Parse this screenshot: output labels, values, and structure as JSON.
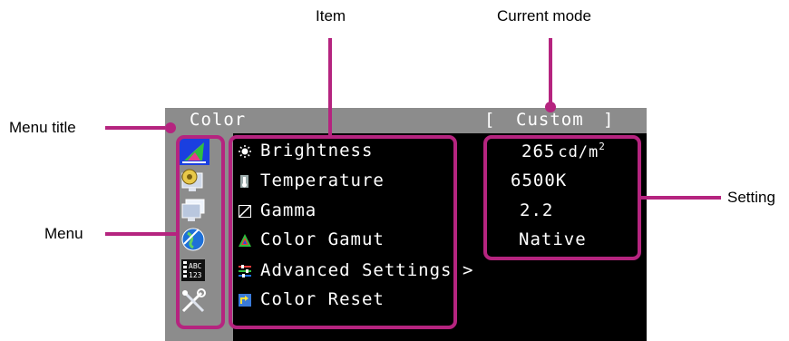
{
  "callouts": {
    "item": "Item",
    "current_mode": "Current mode",
    "menu_title": "Menu title",
    "menu": "Menu",
    "setting": "Setting"
  },
  "osd": {
    "title": "Color",
    "mode_open": "[",
    "mode": "Custom",
    "mode_close": "]",
    "items": [
      {
        "label": "Brightness",
        "icon": "brightness-icon"
      },
      {
        "label": "Temperature",
        "icon": "thermometer-icon"
      },
      {
        "label": "Gamma",
        "icon": "gamma-icon"
      },
      {
        "label": "Color Gamut",
        "icon": "color-gamut-icon"
      },
      {
        "label": "Advanced Settings",
        "icon": "advanced-settings-icon",
        "arrow": ">"
      },
      {
        "label": "Color Reset",
        "icon": "color-reset-icon"
      }
    ],
    "settings": {
      "brightness_value": "265",
      "brightness_unit": "cd/m",
      "brightness_sup": "2",
      "temperature": "6500K",
      "gamma": "2.2",
      "color_gamut": "Native"
    },
    "menu_icons": [
      "color-menu-icon",
      "signal-menu-icon",
      "preferences-menu-icon",
      "language-menu-icon",
      "information-menu-icon",
      "administrator-menu-icon"
    ]
  },
  "colors": {
    "highlight": "#b5247f",
    "osd_background": "#000000",
    "title_bar": "#8c8c8c",
    "selected_menu": "#1a3fe0"
  }
}
